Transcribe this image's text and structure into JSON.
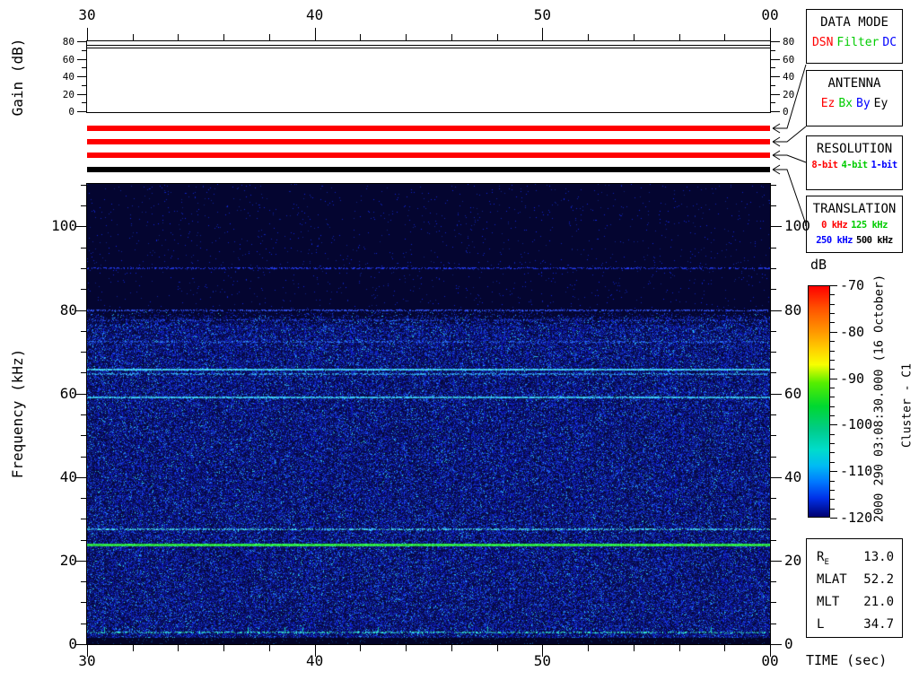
{
  "gain_panel": {
    "ylabel": "Gain (dB)",
    "y_ticks": [
      0,
      20,
      40,
      60,
      80
    ],
    "y_minor_step": 10,
    "y_range": [
      0,
      80
    ],
    "trace_db": [
      77,
      74
    ]
  },
  "time_axis": {
    "label": "TIME (sec)",
    "tick_labels": [
      "30",
      "40",
      "50",
      "00"
    ],
    "tick_sec": [
      30,
      40,
      50,
      60
    ],
    "range_sec": [
      30,
      60
    ],
    "minor_step_sec": 2
  },
  "freq_axis": {
    "label": "Frequency (kHz)",
    "y_ticks": [
      0,
      20,
      40,
      60,
      80,
      100
    ],
    "y_minor_step": 5,
    "range_khz": [
      0,
      110.2
    ]
  },
  "status_bars": [
    {
      "name": "data-mode-bar",
      "color": "#ff0000",
      "indicates": "DSN"
    },
    {
      "name": "antenna-bar",
      "color": "#ff0000",
      "indicates": "Ez"
    },
    {
      "name": "resolution-bar",
      "color": "#ff0000",
      "indicates": "8-bit"
    },
    {
      "name": "translation-bar",
      "color": "#000000",
      "indicates": "500 kHz"
    }
  ],
  "legend_boxes": [
    {
      "title": "DATA MODE",
      "small": false,
      "rows": [
        [
          {
            "label": "DSN",
            "color": "#ff0000"
          },
          {
            "label": "Filter",
            "color": "#00cc00"
          },
          {
            "label": "DC",
            "color": "#0000ff"
          }
        ]
      ]
    },
    {
      "title": "ANTENNA",
      "small": false,
      "rows": [
        [
          {
            "label": "Ez",
            "color": "#ff0000"
          },
          {
            "label": "Bx",
            "color": "#00cc00"
          },
          {
            "label": "By",
            "color": "#0000ff"
          },
          {
            "label": "Ey",
            "color": "#000000"
          }
        ]
      ]
    },
    {
      "title": "RESOLUTION",
      "small": true,
      "rows": [
        [
          {
            "label": "8-bit",
            "color": "#ff0000"
          },
          {
            "label": "4-bit",
            "color": "#00cc00"
          },
          {
            "label": "1-bit",
            "color": "#0000ff"
          }
        ]
      ]
    },
    {
      "title": "TRANSLATION",
      "small": true,
      "rows": [
        [
          {
            "label": "0 kHz",
            "color": "#ff0000"
          },
          {
            "label": "125 kHz",
            "color": "#00cc00"
          }
        ],
        [
          {
            "label": "250 kHz",
            "color": "#0000ff"
          },
          {
            "label": "500 kHz",
            "color": "#000000"
          }
        ]
      ]
    }
  ],
  "colorbar": {
    "label": "dB",
    "tick_labels": [
      "-70",
      "-80",
      "-90",
      "-100",
      "-110",
      "-120"
    ],
    "tick_db": [
      -70,
      -80,
      -90,
      -100,
      -110,
      -120
    ],
    "minor_step_db": 2,
    "range_db": [
      -70,
      -120
    ],
    "gradient": [
      [
        0,
        "#ff0000"
      ],
      [
        0.1,
        "#ff5500"
      ],
      [
        0.2,
        "#ff9900"
      ],
      [
        0.28,
        "#ffd400"
      ],
      [
        0.34,
        "#f8ff00"
      ],
      [
        0.42,
        "#55ee00"
      ],
      [
        0.52,
        "#00d830"
      ],
      [
        0.62,
        "#00cc88"
      ],
      [
        0.71,
        "#00dccc"
      ],
      [
        0.78,
        "#00baf4"
      ],
      [
        0.85,
        "#0077ff"
      ],
      [
        0.92,
        "#0030e8"
      ],
      [
        1,
        "#000070"
      ]
    ]
  },
  "annotations": {
    "datetime": "2000 290 03:08:30.000 (16 October)",
    "spacecraft": "Cluster - C1"
  },
  "ephemeris": {
    "rows": [
      {
        "label": "R",
        "sub": "E",
        "value": "13.0"
      },
      {
        "label": "MLAT",
        "sub": "",
        "value": "52.2"
      },
      {
        "label": "MLT",
        "sub": "",
        "value": "21.0"
      },
      {
        "label": "L",
        "sub": "",
        "value": "34.7"
      }
    ]
  },
  "chart_data": [
    {
      "type": "line",
      "title": "Receiver gain",
      "xlabel": "TIME (sec)",
      "ylabel": "Gain (dB)",
      "x_range_sec": [
        30,
        60
      ],
      "ylim": [
        0,
        80
      ],
      "series": [
        {
          "name": "gain-trace-1",
          "constant_db": 77
        },
        {
          "name": "gain-trace-2",
          "constant_db": 74
        }
      ]
    },
    {
      "type": "heatmap",
      "title": "Cluster C1 WBD spectrogram 2000 290 03:08:30.000 (16 October)",
      "xlabel": "TIME (sec)",
      "ylabel": "Frequency (kHz)",
      "zlabel": "dB",
      "x_range_sec": [
        30,
        60
      ],
      "y_range_khz": [
        0,
        110.2
      ],
      "z_range_db": [
        -120,
        -70
      ],
      "background_noise": "broadband blue noise ~-105 to -115 dB from ~2 to 80 kHz; near noise floor (<=-118 dB, dark navy) above 80 kHz and below ~1.5 kHz",
      "spectral_lines": [
        {
          "freq_khz": 90.0,
          "style": "speckled",
          "color": "#2238e8",
          "strength": 0.55
        },
        {
          "freq_khz": 80.0,
          "style": "speckled",
          "color": "#3050f0",
          "strength": 0.7
        },
        {
          "freq_khz": 77.5,
          "style": "speckled",
          "color": "#2244cc",
          "strength": 0.35
        },
        {
          "freq_khz": 72.5,
          "style": "speckled",
          "color": "#2863e8",
          "strength": 0.4
        },
        {
          "freq_khz": 65.7,
          "style": "solid-speckled",
          "color": "#40c8f8",
          "strength": 0.95
        },
        {
          "freq_khz": 64.6,
          "style": "speckled",
          "color": "#30a0e8",
          "strength": 0.7
        },
        {
          "freq_khz": 59.0,
          "style": "solid-speckled",
          "color": "#38c0f0",
          "strength": 0.85
        },
        {
          "freq_khz": 27.5,
          "style": "speckled",
          "color": "#40c8e8",
          "strength": 0.8
        },
        {
          "freq_khz": 23.8,
          "style": "solid",
          "color": "#2ee84a",
          "strength": 1.0
        },
        {
          "freq_khz": 2.8,
          "style": "speckled-ticks",
          "color": "#30d8c8",
          "strength": 0.55
        }
      ]
    }
  ]
}
